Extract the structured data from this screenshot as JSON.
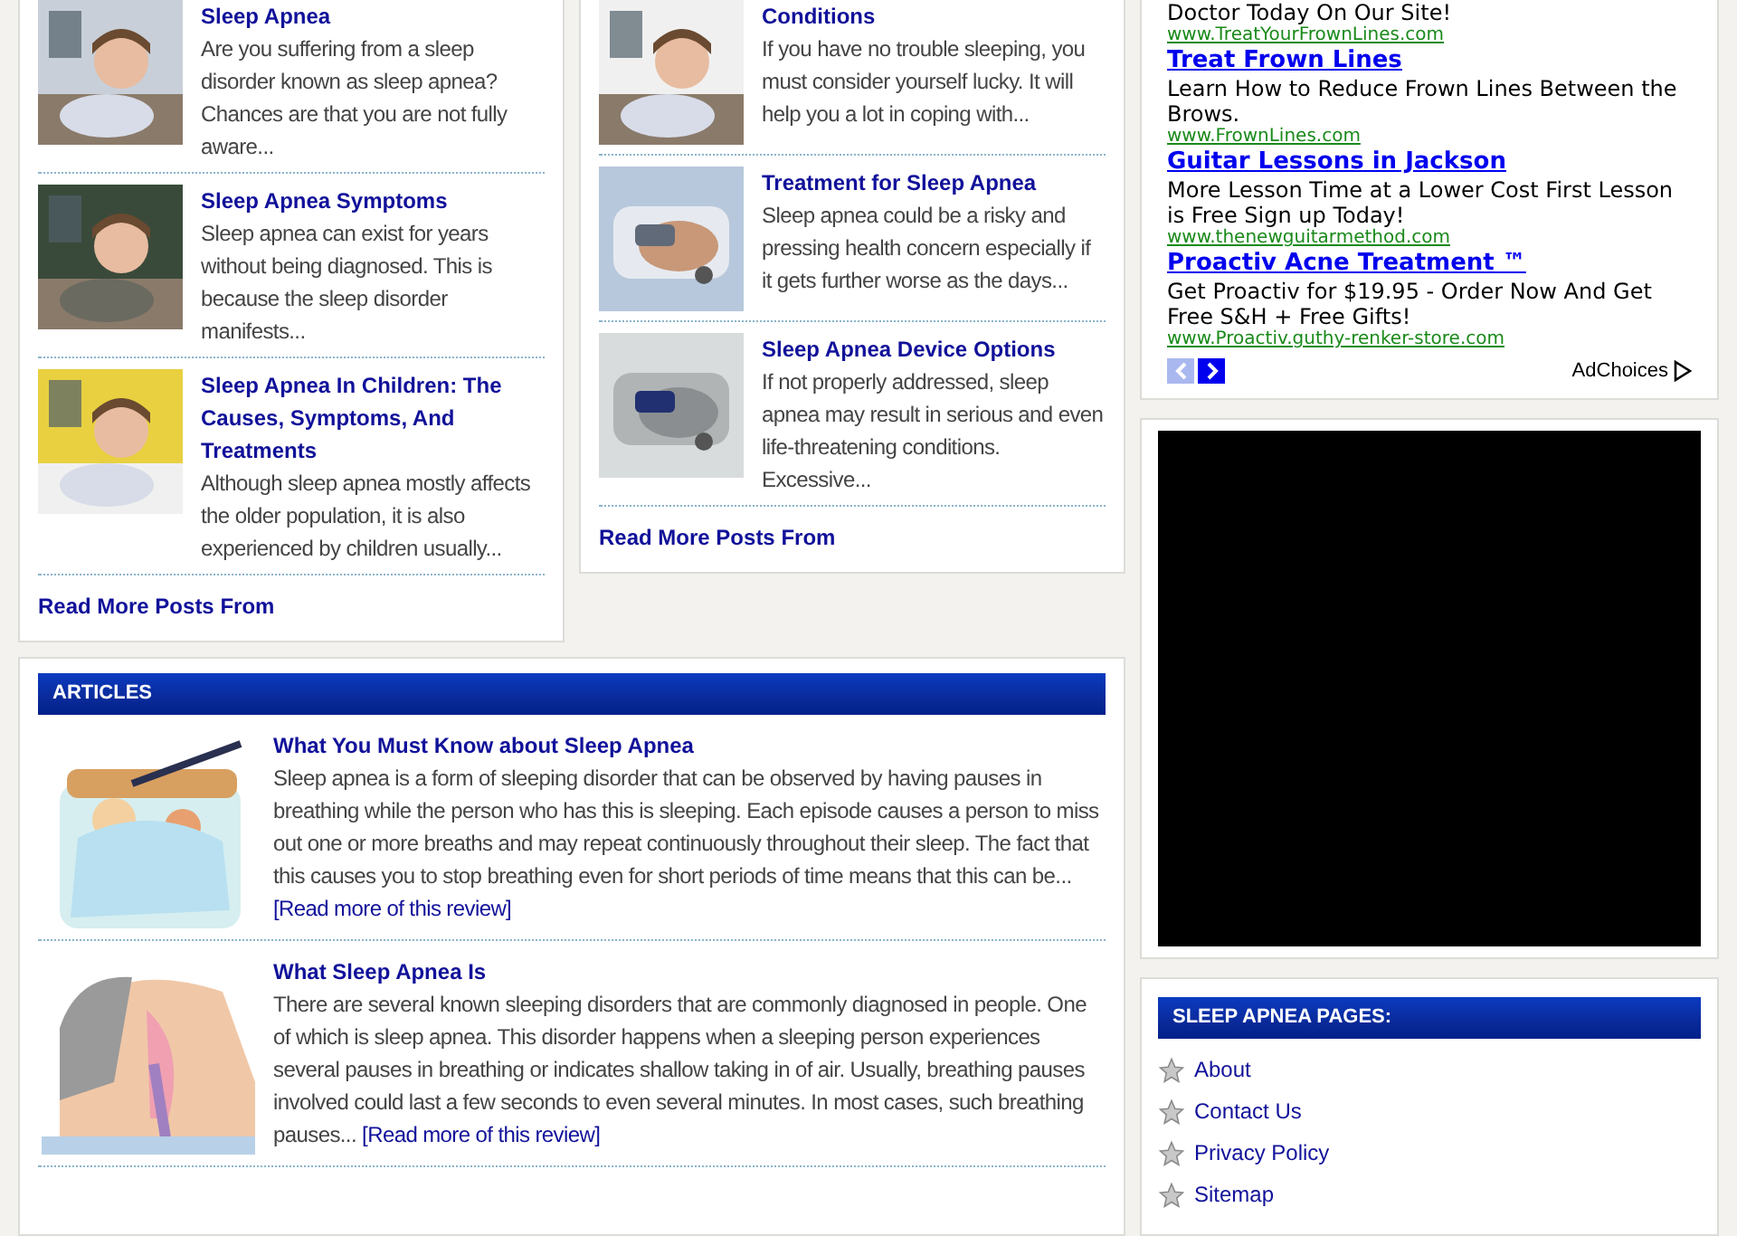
{
  "left_posts": {
    "posts": [
      {
        "title": "Sleep Apnea",
        "excerpt": "Are you suffering from a sleep disorder known as sleep apnea? Chances are that you are not fully aware..."
      },
      {
        "title": "Sleep Apnea Symptoms",
        "excerpt": "Sleep apnea can exist for years without being diagnosed. This is because the sleep disorder manifests..."
      },
      {
        "title": "Sleep Apnea In Children: The Causes, Symptoms, And Treatments",
        "excerpt": "Although sleep apnea mostly affects the older population, it is also experienced by children usually..."
      }
    ],
    "read_more": "Read More Posts From"
  },
  "middle_posts": {
    "posts": [
      {
        "title": "Conditions",
        "excerpt": "If you have no trouble sleeping, you must consider yourself lucky. It will help you a lot in coping with..."
      },
      {
        "title": "Treatment for Sleep Apnea",
        "excerpt": "Sleep apnea could be a risky and pressing health concern especially if it gets further worse as the days..."
      },
      {
        "title": "Sleep Apnea Device Options",
        "excerpt": "If not properly addressed, sleep apnea may result in serious and even life-threatening conditions. Excessive..."
      }
    ],
    "read_more": "Read More Posts From"
  },
  "articles": {
    "heading": "ARTICLES",
    "items": [
      {
        "title": "What You Must Know about Sleep Apnea",
        "excerpt": "Sleep apnea is a form of sleeping disorder that can be observed by having pauses in breathing while the person who has this is sleeping. Each episode causes a person to miss out one or more breaths and may repeat continuously throughout their sleep. The fact that this causes you to stop breathing even for short periods of time means that this can be...",
        "link": "[Read more of this review]"
      },
      {
        "title": "What Sleep Apnea Is",
        "excerpt": "There are several known sleeping disorders that are commonly diagnosed in people. One of which is sleep apnea. This disorder happens when a sleeping person experiences several pauses in breathing or indicates shallow taking in of air. Usually, breathing pauses involved could last a few seconds to even several minutes. In most cases, such breathing pauses...",
        "link": "[Read more of this review]"
      }
    ]
  },
  "ads": {
    "items": [
      {
        "text": "Doctor Today On Our Site!",
        "url": "www.TreatYourFrownLines.com"
      },
      {
        "title": "Treat Frown Lines",
        "text": "Learn How to Reduce Frown Lines Between the Brows.",
        "url": "www.FrownLines.com"
      },
      {
        "title": "Guitar Lessons in Jackson",
        "text": "More Lesson Time at a Lower Cost First Lesson is Free Sign up Today!",
        "url": "www.thenewguitarmethod.com"
      },
      {
        "title": "Proactiv Acne Treatment ™",
        "text": "Get Proactiv for $19.95 - Order Now And Get Free S&H + Free Gifts!",
        "url": "www.Proactiv.guthy-renker-store.com"
      }
    ],
    "prev": {
      "disabled": true
    },
    "next": {
      "disabled": false
    },
    "adchoices": "AdChoices"
  },
  "pages": {
    "heading": "SLEEP APNEA PAGES:",
    "links": [
      "About",
      "Contact Us",
      "Privacy Policy",
      "Sitemap"
    ]
  }
}
